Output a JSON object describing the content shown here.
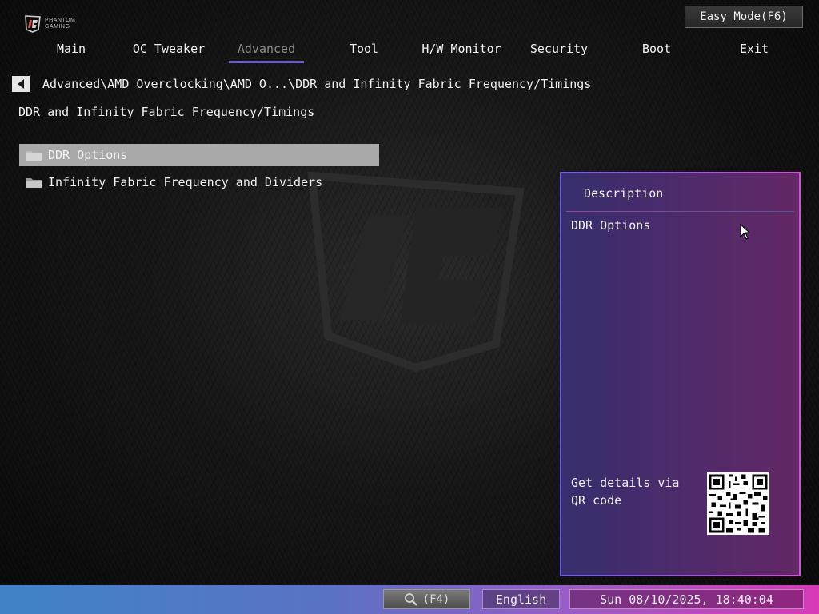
{
  "brand": {
    "line1": "PHANTOM",
    "line2": "GAMING"
  },
  "header": {
    "easy_mode_label": "Easy Mode(F6)"
  },
  "tabs": [
    {
      "label": "Main",
      "active": false
    },
    {
      "label": "OC Tweaker",
      "active": false
    },
    {
      "label": "Advanced",
      "active": true
    },
    {
      "label": "Tool",
      "active": false
    },
    {
      "label": "H/W Monitor",
      "active": false
    },
    {
      "label": "Security",
      "active": false
    },
    {
      "label": "Boot",
      "active": false
    },
    {
      "label": "Exit",
      "active": false
    }
  ],
  "breadcrumb": "Advanced\\AMD Overclocking\\AMD O...\\DDR and Infinity Fabric Frequency/Timings",
  "page_title": "DDR and Infinity Fabric Frequency/Timings",
  "menu": [
    {
      "label": "DDR Options",
      "icon": "folder-icon",
      "selected": true
    },
    {
      "label": "Infinity Fabric Frequency and Dividers",
      "icon": "folder-icon",
      "selected": false
    }
  ],
  "description": {
    "title": "Description",
    "body": "DDR Options",
    "qr_text": "Get details via QR code"
  },
  "status_bar": {
    "search_label": "(F4)",
    "language": "English",
    "datetime": "Sun 08/10/2025, 18:40:04"
  },
  "colors": {
    "accent": "#6a5fc8",
    "selected_bg": "#a9a9a9",
    "panel_border_left": "#6d5ce8",
    "panel_border_right": "#d44fd6"
  }
}
